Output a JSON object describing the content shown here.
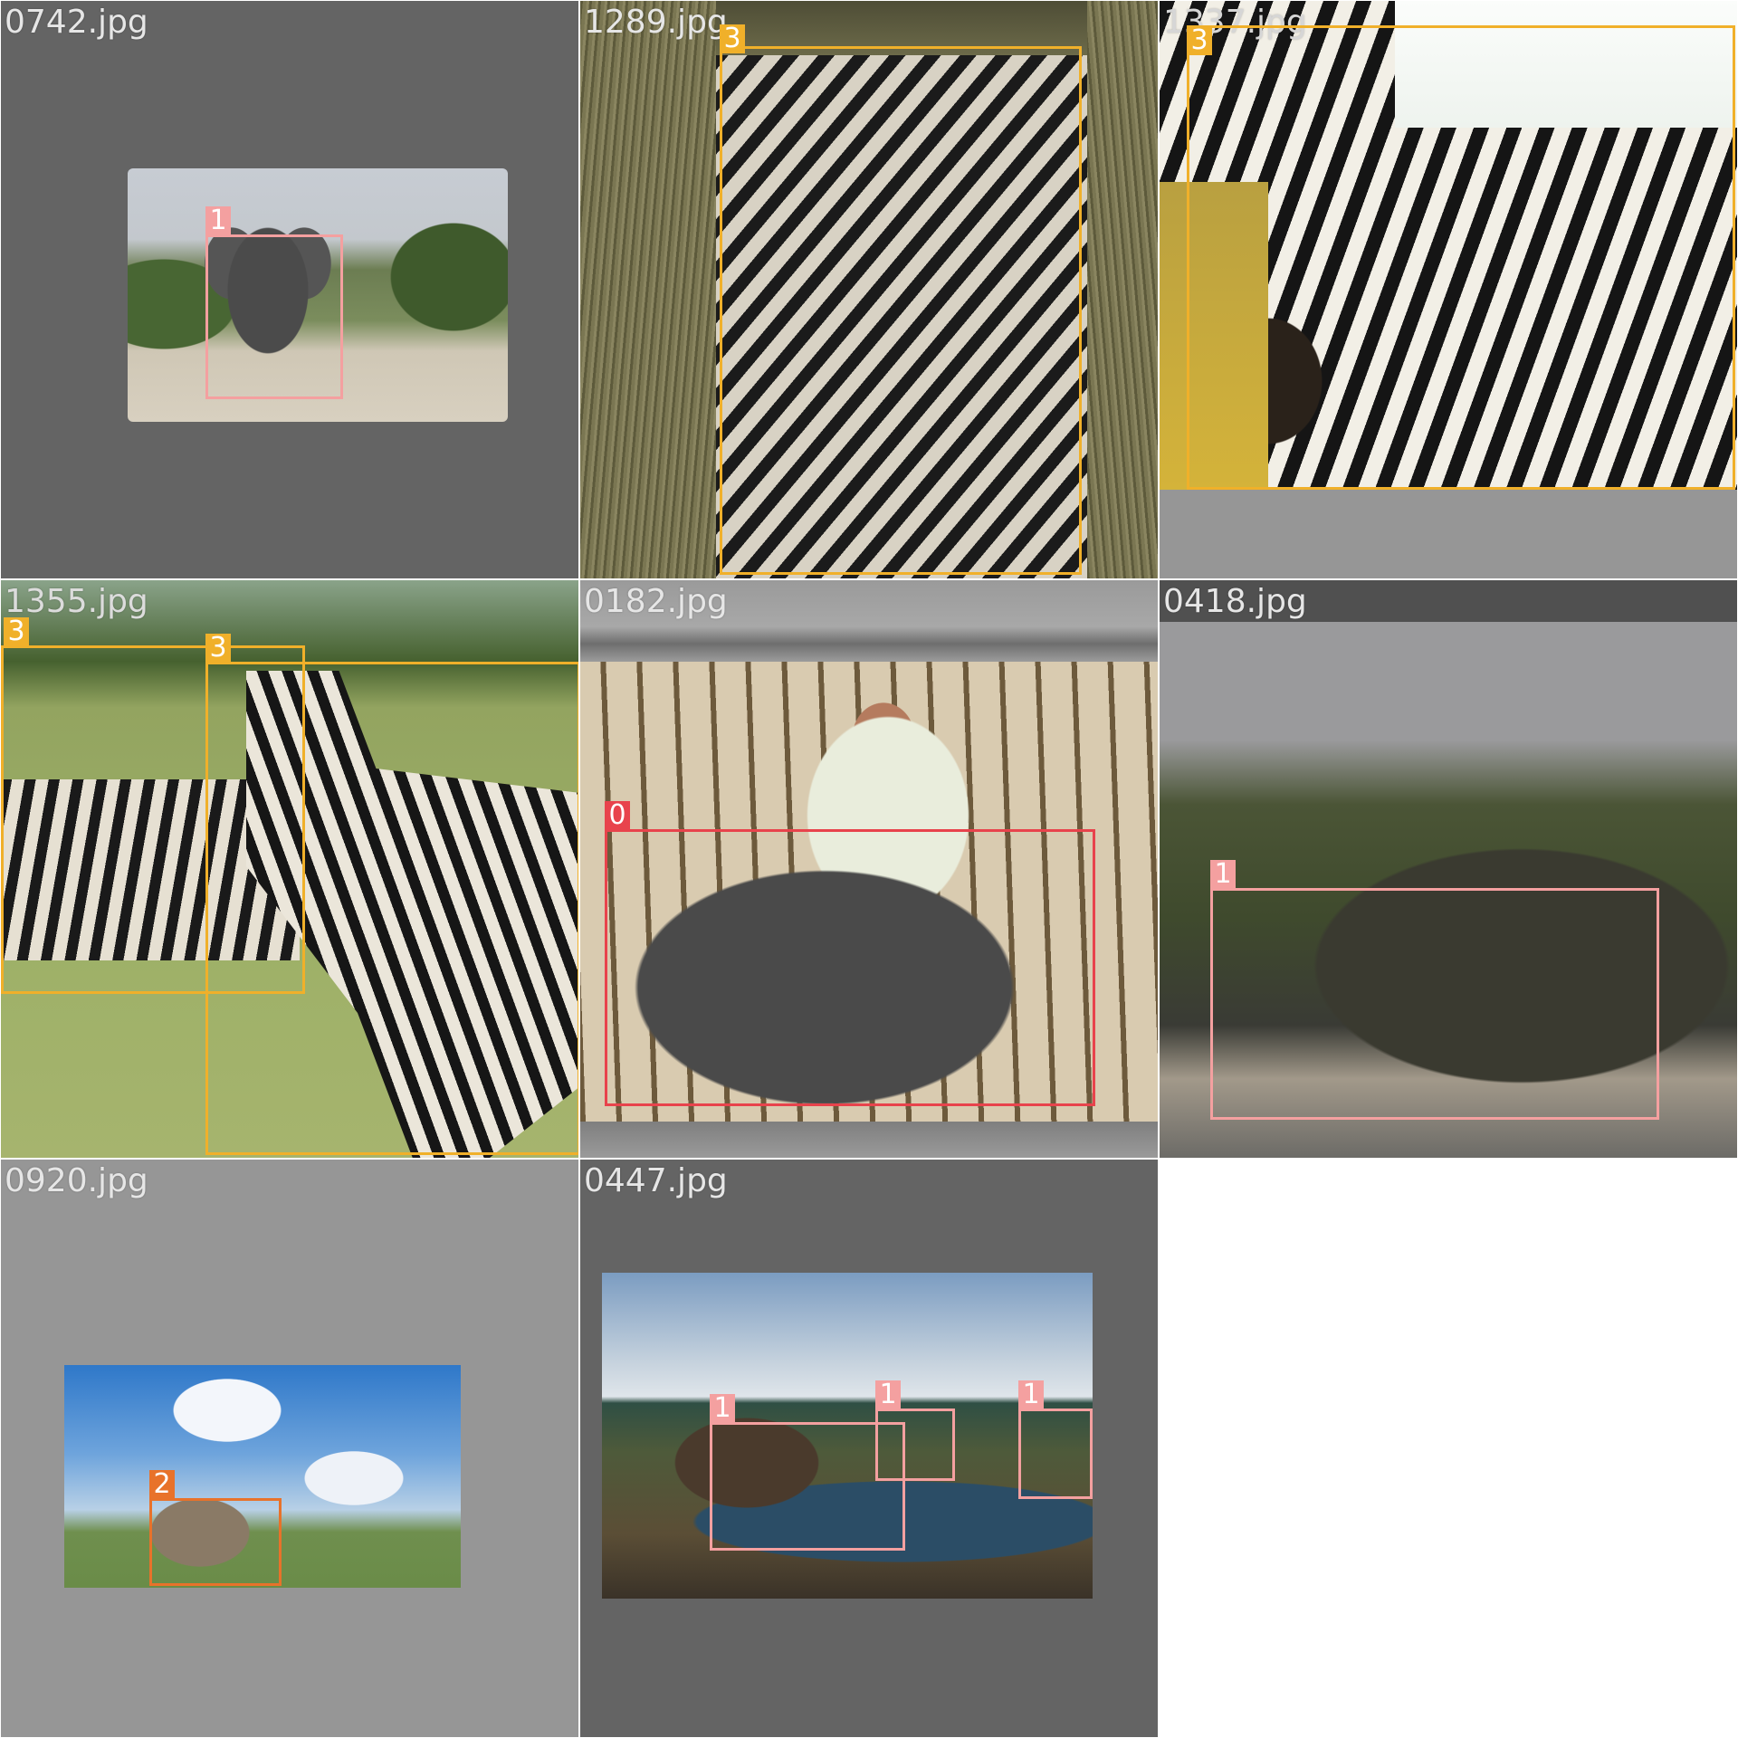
{
  "palette": {
    "class_colors": {
      "0": "#e8434c",
      "1": "#f4a0a0",
      "2": "#e8722a",
      "3": "#f0b02a"
    },
    "grid_line": "#ffffff",
    "label_text": "#e6e6e6"
  },
  "tiles": [
    {
      "filename": "0742.jpg",
      "pad_color": "#646464",
      "scene": "elephant on a dirt road, letterboxed small photo",
      "detections": [
        {
          "class_id": "1"
        }
      ]
    },
    {
      "filename": "1289.jpg",
      "pad_color": "#5a6040",
      "scene": "zebra raising head in tall dry grass",
      "detections": [
        {
          "class_id": "3"
        }
      ]
    },
    {
      "filename": "1337.jpg",
      "pad_color": "#969696",
      "scene": "close-up zebra head and mane over golden grass",
      "detections": [
        {
          "class_id": "3"
        }
      ]
    },
    {
      "filename": "1355.jpg",
      "pad_color": "#7d8a4a",
      "scene": "two zebras standing in green grass",
      "detections": [
        {
          "class_id": "3"
        },
        {
          "class_id": "3"
        }
      ]
    },
    {
      "filename": "0182.jpg",
      "pad_color": "#9a9a9a",
      "scene": "hunter kneeling behind a downed cape buffalo",
      "detections": [
        {
          "class_id": "0"
        }
      ]
    },
    {
      "filename": "0418.jpg",
      "pad_color": "#505050",
      "scene": "elephant in a zoo enclosure with visitors behind a fence",
      "detections": [
        {
          "class_id": "1"
        }
      ]
    },
    {
      "filename": "0920.jpg",
      "pad_color": "#969696",
      "scene": "rhinoceros on green plain under blue sky",
      "detections": [
        {
          "class_id": "2"
        }
      ]
    },
    {
      "filename": "0447.jpg",
      "pad_color": "#646464",
      "scene": "elephants at a waterhole on the savanna",
      "detections": [
        {
          "class_id": "1"
        },
        {
          "class_id": "1"
        },
        {
          "class_id": "1"
        }
      ]
    }
  ]
}
